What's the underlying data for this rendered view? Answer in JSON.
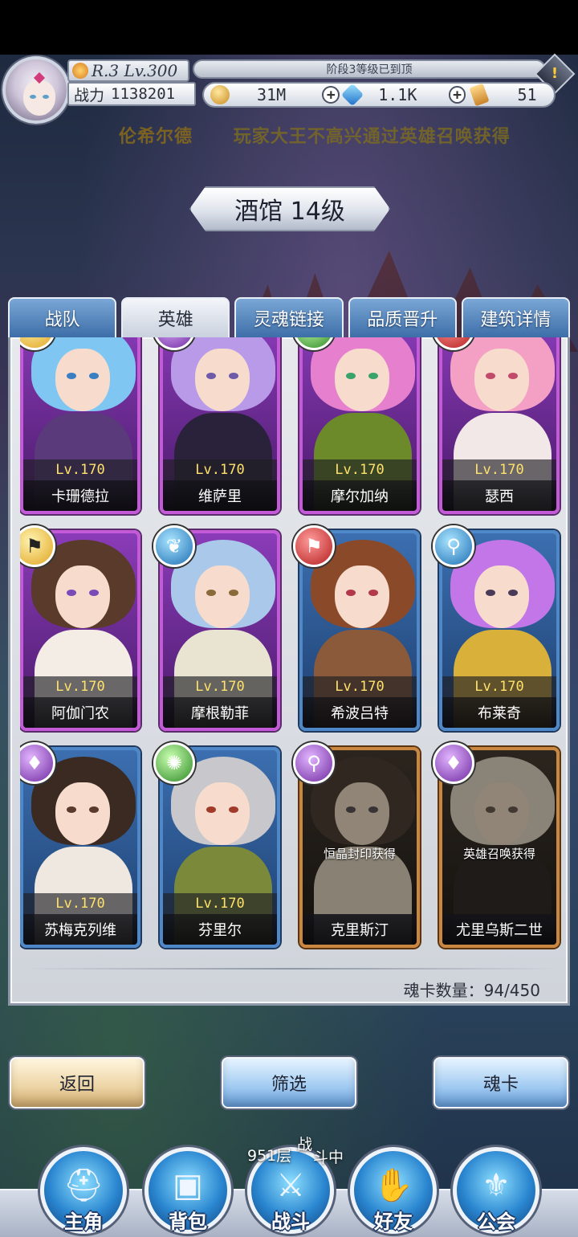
{
  "header": {
    "rank_text": "R.3 Lv.300",
    "stage_text": "阶段3等级已到顶",
    "info_icon": "exclamation-diamond-icon",
    "power_label": "战力",
    "power_value": "1138201",
    "resources": [
      {
        "icon": "gold-coin-icon",
        "value": "31M",
        "color": "#d9a33a"
      },
      {
        "icon": "blue-crystal-icon",
        "value": "1.1K",
        "color": "#2f8fe0"
      },
      {
        "icon": "card-ticket-icon",
        "value": "51",
        "color": "#e4a23c"
      }
    ]
  },
  "broadcast": {
    "name": "伦希尔德",
    "message": "玩家大王不高兴通过英雄召唤获得"
  },
  "building_title": "酒馆 14级",
  "tabs": [
    {
      "label": "战队",
      "active": false
    },
    {
      "label": "英雄",
      "active": true
    },
    {
      "label": "灵魂链接",
      "active": false
    },
    {
      "label": "品质晋升",
      "active": false
    },
    {
      "label": "建筑详情",
      "active": false
    }
  ],
  "heroes": [
    {
      "name": "卡珊德拉",
      "level": "Lv.170",
      "rarity": "purple",
      "class_icon": "sword-class-icon",
      "class_color": "gold",
      "hair": "#7fc6f2",
      "eye": "#3a7fc2",
      "outfit": "#5a3a7a"
    },
    {
      "name": "维萨里",
      "level": "Lv.170",
      "rarity": "purple",
      "class_icon": "bow-class-icon",
      "class_color": "purple",
      "hair": "#b89ae8",
      "eye": "#6e5aa8",
      "outfit": "#2a223a"
    },
    {
      "name": "摩尔加纳",
      "level": "Lv.170",
      "rarity": "purple",
      "class_icon": "staff-class-icon",
      "class_color": "green",
      "hair": "#e77fcf",
      "eye": "#3aa36a",
      "outfit": "#6c8a2a"
    },
    {
      "name": "瑟西",
      "level": "Lv.170",
      "rarity": "purple",
      "class_icon": "blade-class-icon",
      "class_color": "red",
      "hair": "#f4a0c4",
      "eye": "#c24a6a",
      "outfit": "#f2e8e8"
    },
    {
      "name": "阿伽门农",
      "level": "Lv.170",
      "rarity": "purple",
      "class_icon": "flag-class-icon",
      "class_color": "gold",
      "hair": "#5a3a2a",
      "eye": "#7a4ab8",
      "outfit": "#f3ede6"
    },
    {
      "name": "摩根勒菲",
      "level": "Lv.170",
      "rarity": "purple",
      "class_icon": "wings-class-icon",
      "class_color": "blue",
      "hair": "#aac8ea",
      "eye": "#8a6a3a",
      "outfit": "#e9e3d2"
    },
    {
      "name": "希波吕特",
      "level": "Lv.170",
      "rarity": "blue",
      "class_icon": "flag-class-icon",
      "class_color": "red",
      "hair": "#8a4a2a",
      "eye": "#b2384a",
      "outfit": "#8a5a3a"
    },
    {
      "name": "布莱奇",
      "level": "Lv.170",
      "rarity": "blue",
      "class_icon": "magnifier-class-icon",
      "class_color": "blue",
      "hair": "#c276e8",
      "eye": "#4a3a5a",
      "outfit": "#d8b03a"
    },
    {
      "name": "苏梅克列维",
      "level": "Lv.170",
      "rarity": "blue",
      "class_icon": "dagger-class-icon",
      "class_color": "purple",
      "hair": "#3a2a22",
      "eye": "#5a3a2a",
      "outfit": "#eee8e0"
    },
    {
      "name": "芬里尔",
      "level": "Lv.170",
      "rarity": "blue",
      "class_icon": "swirl-class-icon",
      "class_color": "green",
      "hair": "#c8c8cc",
      "eye": "#a23a2a",
      "outfit": "#7a8a3a"
    },
    {
      "name": "克里斯汀",
      "level": "",
      "rarity": "locked",
      "class_icon": "magnifier-class-icon",
      "class_color": "purple",
      "locked_note": "恒晶封印获得",
      "hair": "#6a3a2a",
      "eye": "#6a4a8a",
      "outfit": "#e0d8d0"
    },
    {
      "name": "尤里乌斯二世",
      "level": "",
      "rarity": "locked",
      "class_icon": "dagger-class-icon",
      "class_color": "purple",
      "locked_note": "英雄召唤获得",
      "hair": "#dcdce4",
      "eye": "#7a5a4a",
      "outfit": "#3a2a2a"
    }
  ],
  "card_count": "魂卡数量：94/450",
  "buttons": {
    "back": "返回",
    "filter": "筛选",
    "soul_card": "魂卡"
  },
  "battle_status": {
    "floor": "951层",
    "s1": "战",
    "s2": "斗中"
  },
  "nav": [
    {
      "label": "主角",
      "icon": "helmet-icon"
    },
    {
      "label": "背包",
      "icon": "backpack-icon"
    },
    {
      "label": "战斗",
      "icon": "crossed-swords-icon"
    },
    {
      "label": "好友",
      "icon": "handshake-icon"
    },
    {
      "label": "公会",
      "icon": "guild-crest-icon"
    }
  ]
}
